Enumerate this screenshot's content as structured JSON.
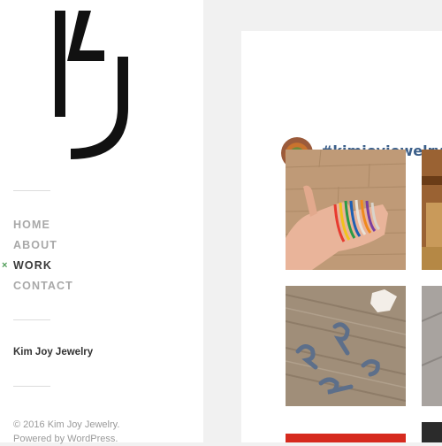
{
  "nav": {
    "items": [
      {
        "label": "HOME"
      },
      {
        "label": "ABOUT"
      },
      {
        "label": "WORK"
      },
      {
        "label": "CONTACT"
      }
    ],
    "active_marker": "×"
  },
  "site": {
    "name": "Kim Joy Jewelry",
    "copyright": "© 2016 Kim Joy Jewelry.",
    "powered": "Powered by WordPress."
  },
  "feed": {
    "hashtag": "#kimjoyjewelry",
    "avatar_icon": "avatar"
  },
  "colors": {
    "accent_marker": "#4f9d57",
    "hashtag": "#3b5f8a",
    "active_nav": "#3a3a3a",
    "inactive_nav": "#a8a8a8"
  }
}
